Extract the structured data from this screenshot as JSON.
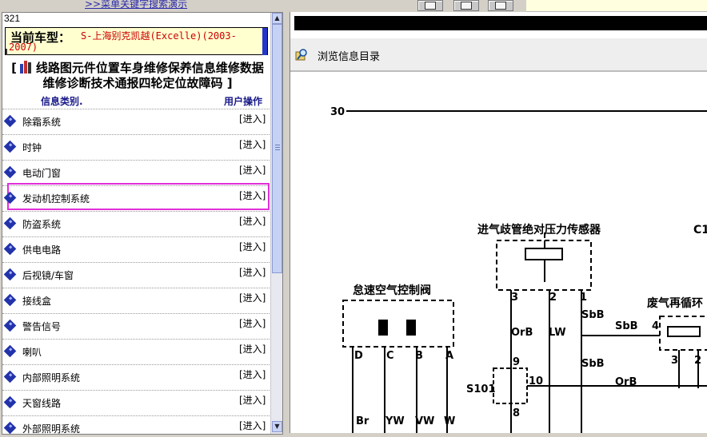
{
  "top": {
    "link": ">>菜单关键字搜索演示"
  },
  "left": {
    "counter": "321",
    "car_label": "当前车型：",
    "car_value": "S-上海别克凯越(Excelle)(2003-",
    "car_value_cont": "2007)",
    "banner_open": "[",
    "banner_text": "线路图元件位置车身维修保养信息维修数据维修诊断技术通报四轮定位故障码",
    "banner_close": "]",
    "col_category": "信息类别.",
    "col_action": "用户操作",
    "rows": [
      {
        "label": "除霜系统",
        "action": "[进入]"
      },
      {
        "label": "时钟",
        "action": "[进入]"
      },
      {
        "label": "电动门窗",
        "action": "[进入]"
      },
      {
        "label": "发动机控制系统",
        "action": "[进入]"
      },
      {
        "label": "防盗系统",
        "action": "[进入]"
      },
      {
        "label": "供电电路",
        "action": "[进入]"
      },
      {
        "label": "后视镜/车窗",
        "action": "[进入]"
      },
      {
        "label": "接线盒",
        "action": "[进入]"
      },
      {
        "label": "警告信号",
        "action": "[进入]"
      },
      {
        "label": "喇叭",
        "action": "[进入]"
      },
      {
        "label": "内部照明系统",
        "action": "[进入]"
      },
      {
        "label": "天窗线路",
        "action": "[进入]"
      },
      {
        "label": "外部照明系统",
        "action": "[进入]"
      }
    ],
    "selected_index": 3,
    "highlight_color": "#e030d8",
    "bullet_icon": "diamond-bullet-icon"
  },
  "right": {
    "browse_label": "浏览信息目录",
    "browse_icon": "magnifier-book-icon",
    "diagram": {
      "line30": "30",
      "map_sensor": "进气歧管绝对压力传感器",
      "idle_valve": "怠速空气控制阀",
      "egr": "废气再循环",
      "c1": "C1",
      "pins_sensor": [
        "3",
        "2",
        "1"
      ],
      "pins_valve": [
        "D",
        "C",
        "B",
        "A"
      ],
      "egr_pins": [
        "4",
        "3",
        "2"
      ],
      "wires": [
        "OrB",
        "LW",
        "SbB",
        "SbB",
        "SbB",
        "OrB",
        "Br",
        "YW",
        "VW",
        "W"
      ],
      "splice": "S101",
      "splice_pins": [
        "9",
        "10",
        "8"
      ]
    }
  }
}
